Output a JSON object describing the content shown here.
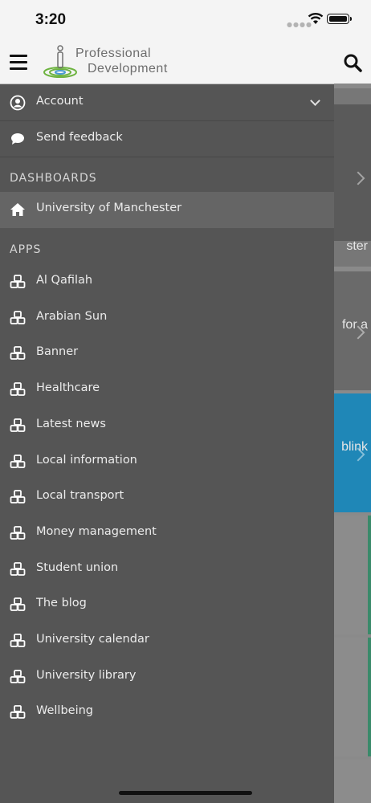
{
  "status_bar": {
    "time": "3:20"
  },
  "header": {
    "logo_line1": "Professional",
    "logo_line2": "Development"
  },
  "background_cards": [
    {
      "text": "ster",
      "color": "#777777"
    },
    {
      "text": "for a",
      "color": "#6a6a6a"
    },
    {
      "text": "blink",
      "color": "#1f87b7"
    },
    {
      "text": "",
      "color": "#8c8c8c"
    },
    {
      "text": "",
      "color": "#8c8c8c"
    },
    {
      "text": "",
      "color": "#8c8c8c"
    }
  ],
  "drawer": {
    "account_label": "Account",
    "feedback_label": "Send feedback",
    "dashboards_heading": "DASHBOARDS",
    "dashboard_item": "University of Manchester",
    "apps_heading": "APPS",
    "apps": [
      "Al Qafilah",
      "Arabian Sun",
      "Banner",
      "Healthcare",
      "Latest news",
      "Local information",
      "Local transport",
      "Money management",
      "Student union",
      "The blog",
      "University calendar",
      "University library",
      "Wellbeing"
    ]
  },
  "icons": {
    "menu": "hamburger-menu-icon",
    "search": "search-icon",
    "account": "user-circle-icon",
    "feedback": "speech-bubble-icon",
    "dashboard": "home-icon",
    "app": "cubes-icon"
  },
  "colors": {
    "drawer_bg": "#555555",
    "active_row": "#656565",
    "header_bg": "#f4f4f4",
    "accent_blue": "#1f87b7",
    "logo_green": "#6db33f"
  }
}
